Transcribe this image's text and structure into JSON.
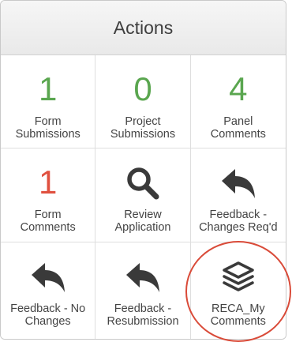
{
  "panel": {
    "title": "Actions"
  },
  "tiles": [
    {
      "count": "1",
      "label_lines": [
        "Form",
        "Submissions"
      ]
    },
    {
      "count": "0",
      "label_lines": [
        "Project",
        "Submissions"
      ]
    },
    {
      "count": "4",
      "label_lines": [
        "Panel",
        "Comments"
      ]
    },
    {
      "count": "1",
      "label_lines": [
        "Form",
        "Comments"
      ]
    },
    {
      "icon": "search-icon",
      "label_lines": [
        "Review",
        "Application"
      ]
    },
    {
      "icon": "reply-arrow-icon",
      "label_lines": [
        "Feedback -",
        "Changes Req'd"
      ]
    },
    {
      "icon": "reply-arrow-icon",
      "label_lines": [
        "Feedback - No",
        "Changes"
      ]
    },
    {
      "icon": "reply-arrow-icon",
      "label_lines": [
        "Feedback -",
        "Resubmission"
      ]
    },
    {
      "icon": "layers-icon",
      "label_lines": [
        "RECA_My",
        "Comments"
      ]
    }
  ],
  "colors": {
    "count_green": "#5aa64f",
    "count_red": "#e0503f",
    "icon_dark": "#3a3a3a",
    "highlight_ring": "#d94a38"
  }
}
